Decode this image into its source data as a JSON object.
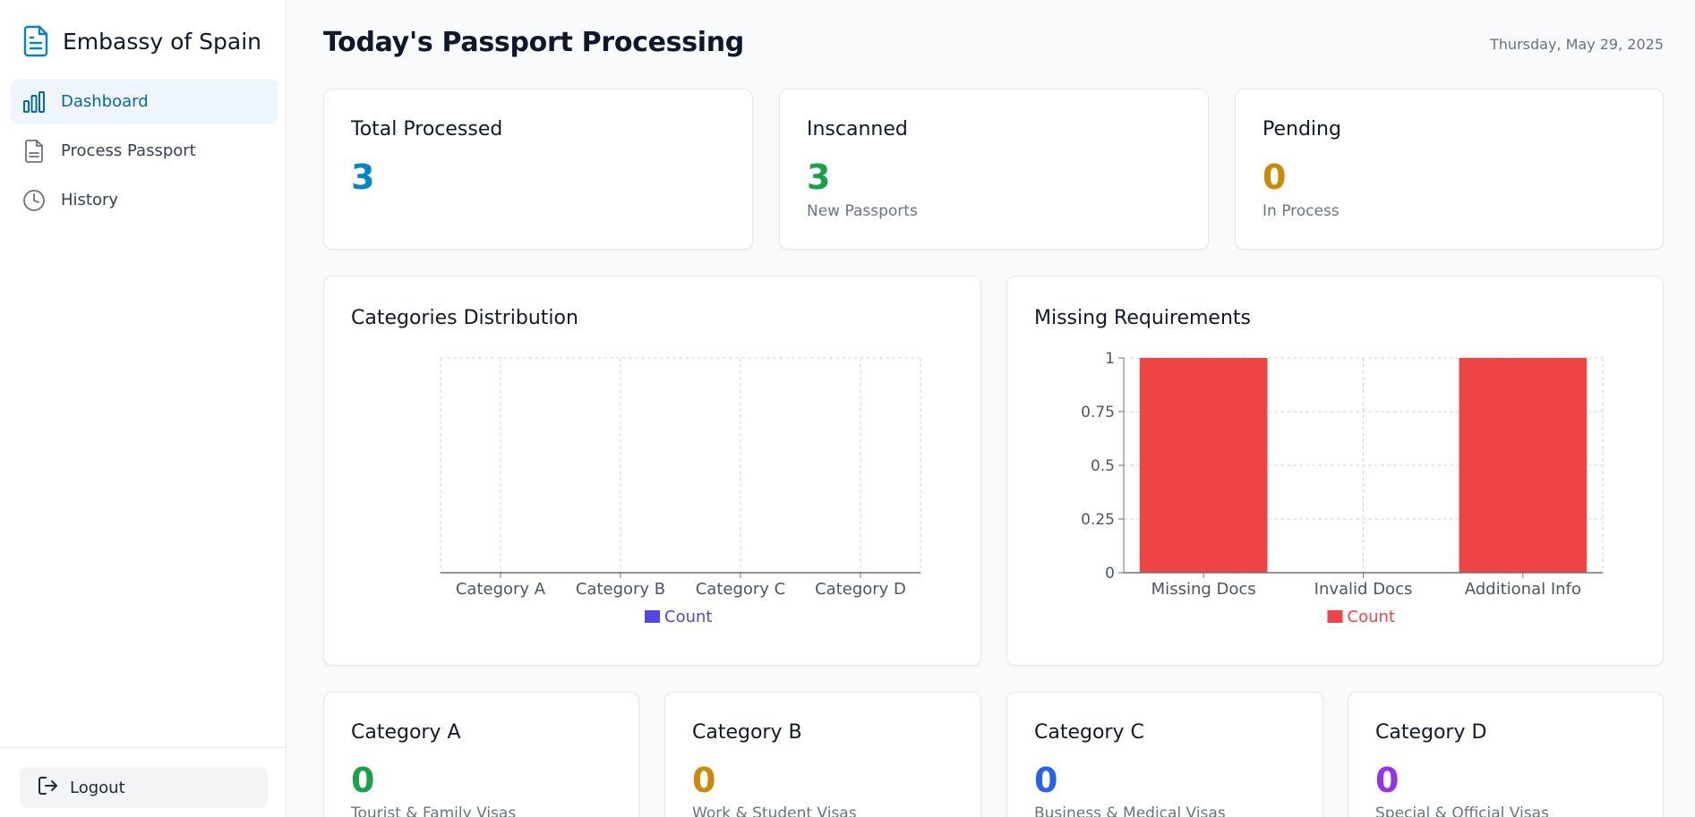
{
  "brand": {
    "title": "Embassy of Spain",
    "icon": "document-icon",
    "color": "#0284c7"
  },
  "sidebar": {
    "items": [
      {
        "label": "Dashboard",
        "icon": "bar-chart-icon",
        "active": true
      },
      {
        "label": "Process Passport",
        "icon": "document-icon",
        "active": false
      },
      {
        "label": "History",
        "icon": "clock-icon",
        "active": false
      }
    ],
    "logout": {
      "label": "Logout",
      "icon": "logout-icon"
    }
  },
  "header": {
    "title": "Today's Passport Processing",
    "date": "Thursday, May 29, 2025"
  },
  "stats": [
    {
      "title": "Total Processed",
      "value": "3",
      "subtitle": "",
      "color": "#0284c7"
    },
    {
      "title": "Inscanned",
      "value": "3",
      "subtitle": "New Passports",
      "color": "#16a34a"
    },
    {
      "title": "Pending",
      "value": "0",
      "subtitle": "In Process",
      "color": "#ca8a04"
    }
  ],
  "chart_data": [
    {
      "type": "bar",
      "title": "Categories Distribution",
      "categories": [
        "Category A",
        "Category B",
        "Category C",
        "Category D"
      ],
      "series": [
        {
          "name": "Count",
          "values": [
            0,
            0,
            0,
            0
          ],
          "color": "#4f46e5"
        }
      ],
      "grid": true,
      "legend": "bottom-center"
    },
    {
      "type": "bar",
      "title": "Missing Requirements",
      "categories": [
        "Missing Docs",
        "Invalid Docs",
        "Additional Info"
      ],
      "series": [
        {
          "name": "Count",
          "values": [
            1,
            0,
            1
          ],
          "color": "#ef4444"
        }
      ],
      "yticks": [
        "0",
        "0.25",
        "0.5",
        "0.75",
        "1"
      ],
      "ylim": [
        0,
        1
      ],
      "grid": true,
      "legend": "bottom-center"
    }
  ],
  "categories": [
    {
      "title": "Category A",
      "value": "0",
      "subtitle": "Tourist & Family Visas",
      "color": "#16a34a"
    },
    {
      "title": "Category B",
      "value": "0",
      "subtitle": "Work & Student Visas",
      "color": "#ca8a04"
    },
    {
      "title": "Category C",
      "value": "0",
      "subtitle": "Business & Medical Visas",
      "color": "#2563eb"
    },
    {
      "title": "Category D",
      "value": "0",
      "subtitle": "Special & Official Visas",
      "color": "#9333ea"
    }
  ]
}
